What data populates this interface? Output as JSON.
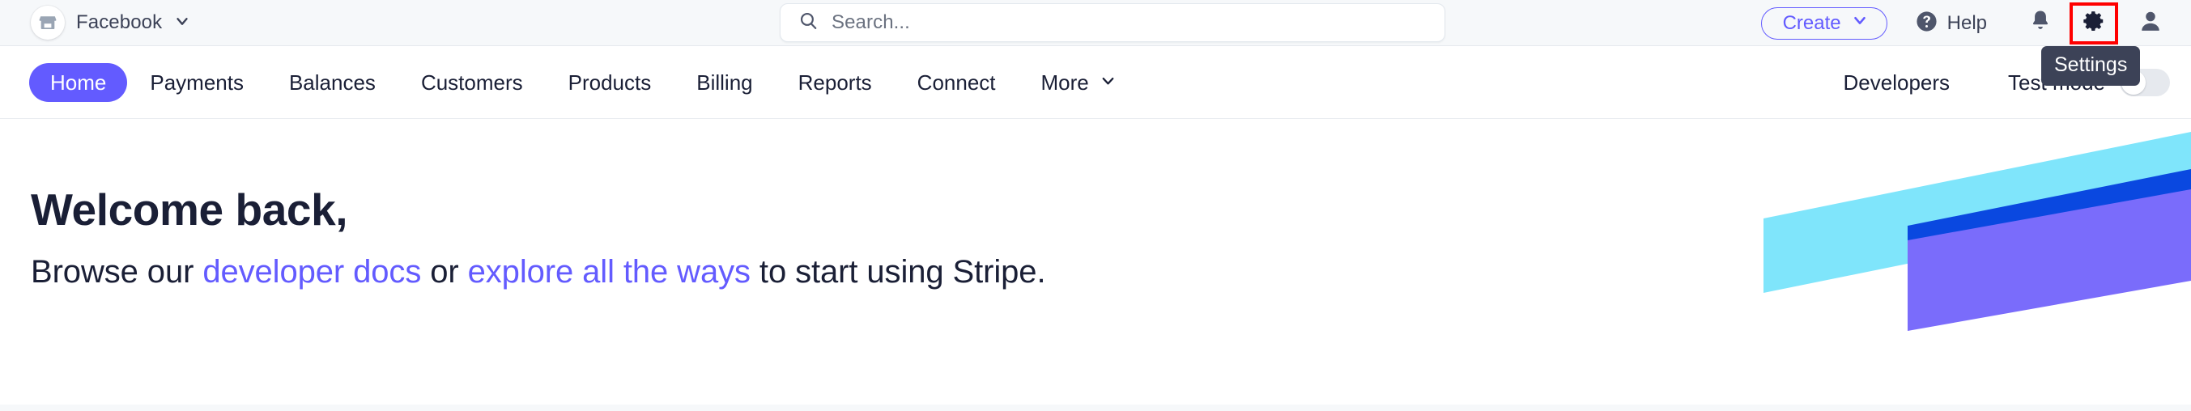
{
  "topbar": {
    "merchant": {
      "icon": "storefront-icon",
      "name": "Facebook",
      "chevron": "chevron-down-icon"
    },
    "search": {
      "icon": "search-icon",
      "placeholder": "Search...",
      "value": ""
    },
    "create_button": {
      "label": "Create",
      "chevron": "chevron-down-icon"
    },
    "help_button": {
      "icon": "help-circle-icon",
      "label": "Help"
    },
    "notifications_icon": "bell-icon",
    "settings_icon": "gear-icon",
    "account_icon": "user-avatar-icon",
    "settings_tooltip": "Settings",
    "highlight_color": "#ff0000"
  },
  "nav": {
    "items": [
      {
        "label": "Home",
        "active": true
      },
      {
        "label": "Payments",
        "active": false
      },
      {
        "label": "Balances",
        "active": false
      },
      {
        "label": "Customers",
        "active": false
      },
      {
        "label": "Products",
        "active": false
      },
      {
        "label": "Billing",
        "active": false
      },
      {
        "label": "Reports",
        "active": false
      },
      {
        "label": "Connect",
        "active": false
      },
      {
        "label": "More",
        "active": false,
        "chevron": "chevron-down-icon"
      }
    ],
    "developers_link": "Developers",
    "test_mode_label": "Test mode",
    "test_mode_on": false,
    "active_color": "#635bff"
  },
  "main": {
    "heading": "Welcome back,",
    "subtitle": {
      "prefix": "Browse our ",
      "link1": "developer docs",
      "middle": " or ",
      "link2": "explore all the ways",
      "suffix": " to start using Stripe."
    },
    "link_color": "#635bff",
    "decoration": {
      "name": "ribbon-graphic",
      "colors": {
        "cyan": "#7fe5fb",
        "deep_blue": "#0a48e0",
        "purple": "#7a6cfb"
      }
    }
  }
}
